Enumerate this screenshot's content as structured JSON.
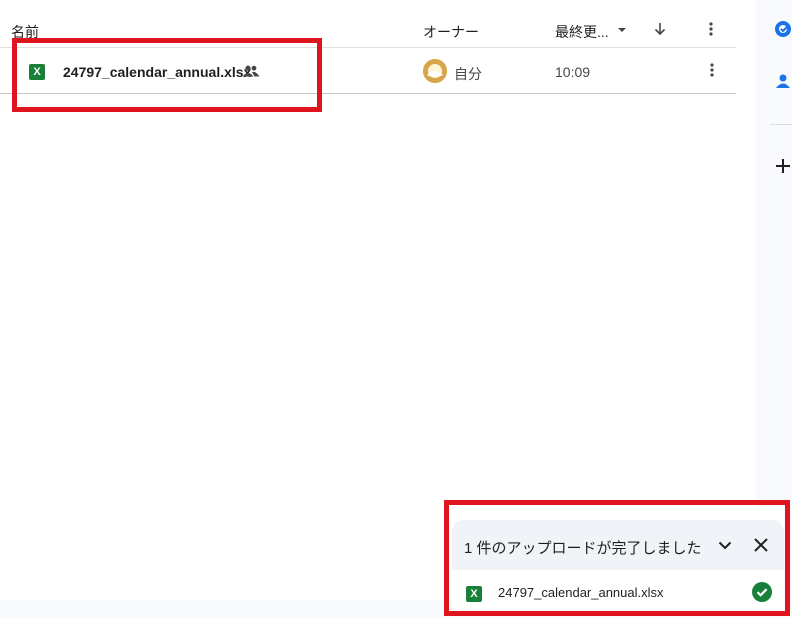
{
  "columns": {
    "name": "名前",
    "owner": "オーナー",
    "modified": "最終更..."
  },
  "files": [
    {
      "name": "24797_calendar_annual.xlsx",
      "type_icon": "excel-icon",
      "type_letter": "X",
      "shared": true,
      "owner": "自分",
      "modified": "10:09"
    }
  ],
  "upload": {
    "title": "1 件のアップロードが完了しました",
    "item_name": "24797_calendar_annual.xlsx",
    "item_letter": "X",
    "status_icon": "check-circle-icon"
  },
  "colors": {
    "excel_green": "#188038",
    "highlight_red": "#e0141e",
    "drive_blue": "#1a73e8"
  }
}
